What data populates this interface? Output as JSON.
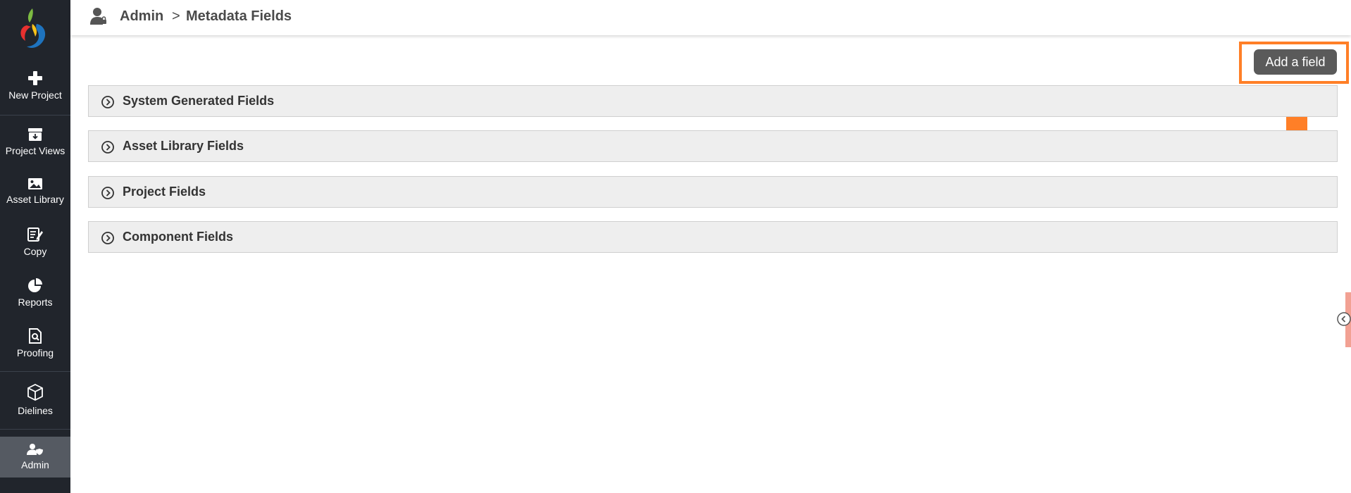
{
  "app": {
    "colors": {
      "sidebar_bg": "#21252c",
      "panel_bg": "#eeeeee",
      "button_bg": "#5a5a5a",
      "highlight": "#ff7f27"
    }
  },
  "sidebar": {
    "items": [
      {
        "label": "New Project",
        "icon": "plus-icon"
      },
      {
        "label": "Project Views",
        "icon": "archive-box-icon"
      },
      {
        "label": "Asset Library",
        "icon": "image-icon"
      },
      {
        "label": "Copy",
        "icon": "edit-document-icon"
      },
      {
        "label": "Reports",
        "icon": "pie-chart-icon"
      },
      {
        "label": "Proofing",
        "icon": "document-search-icon"
      },
      {
        "label": "Dielines",
        "icon": "cube-icon"
      },
      {
        "label": "Admin",
        "icon": "user-shield-icon",
        "active": true
      }
    ]
  },
  "header": {
    "icon": "admin-user-icon",
    "breadcrumb": {
      "root": "Admin",
      "separator": ">",
      "current": "Metadata Fields"
    }
  },
  "main": {
    "add_button_label": "Add a field",
    "sections": [
      {
        "title": "System Generated Fields",
        "icon": "chevron-right-circle-icon"
      },
      {
        "title": "Asset Library Fields",
        "icon": "chevron-right-circle-icon"
      },
      {
        "title": "Project Fields",
        "icon": "chevron-right-circle-icon"
      },
      {
        "title": "Component Fields",
        "icon": "chevron-right-circle-icon"
      }
    ]
  },
  "annotation": {
    "icon": "up-arrow-icon"
  },
  "side_panel_toggle": {
    "icon": "chevron-left-circle-icon"
  }
}
